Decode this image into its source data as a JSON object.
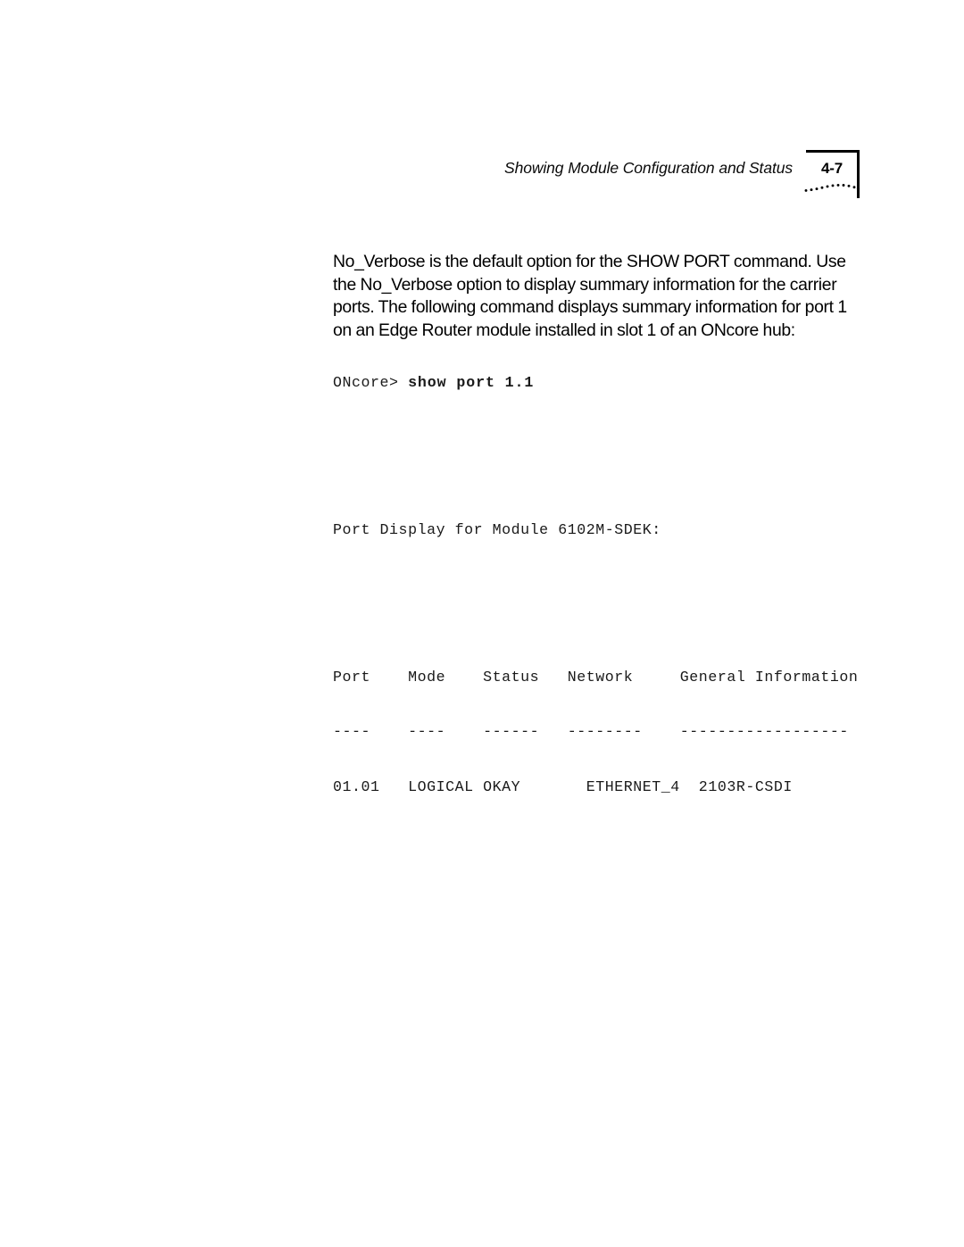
{
  "page": {
    "background_color": "#ffffff",
    "text_color": "#000000"
  },
  "header": {
    "title": "Showing Module Configuration and Status",
    "page_number": "4-7",
    "decoration": "dotted-wave"
  },
  "body": {
    "paragraph": "No_Verbose is the default option for the SHOW PORT command. Use the No_Verbose option to display summary information for the carrier ports. The following command displays summary information for port 1 on an Edge Router module installed in slot 1 of an ONcore hub:"
  },
  "console": {
    "prompt": "ONcore> ",
    "command": "show port 1.1",
    "output_heading": "Port Display for Module 6102M-SDEK:",
    "table": {
      "header_line": "Port    Mode    Status   Network     General Information",
      "separator_line": "----    ----    ------   --------    ------------------",
      "rows": [
        "01.01   LOGICAL OKAY       ETHERNET_4  2103R-CSDI"
      ],
      "columns": [
        "Port",
        "Mode",
        "Status",
        "Network",
        "General Information"
      ],
      "cells": [
        {
          "port": "01.01",
          "mode": "LOGICAL",
          "status": "OKAY",
          "network": "ETHERNET_4",
          "general_information": "2103R-CSDI"
        }
      ]
    }
  }
}
